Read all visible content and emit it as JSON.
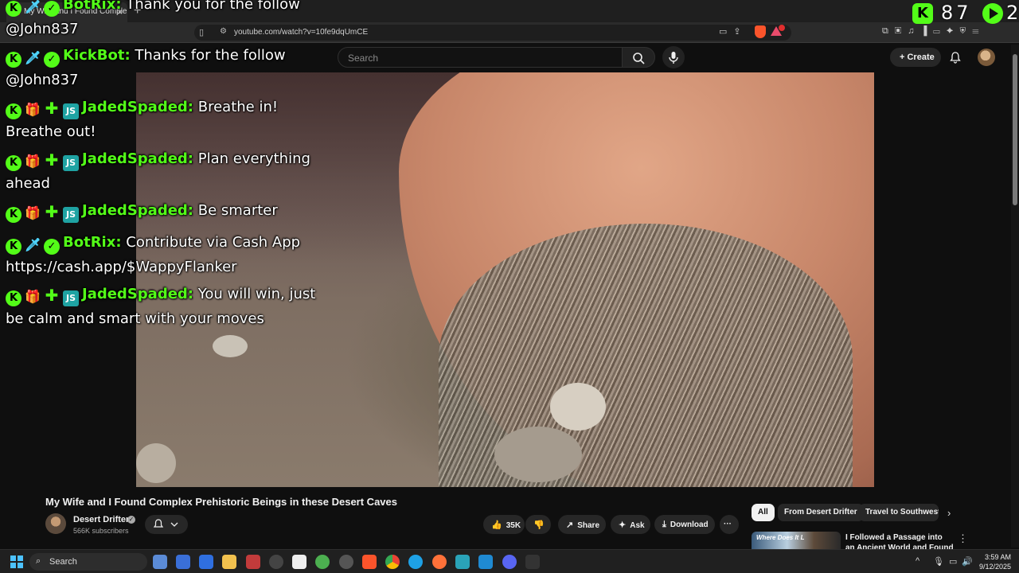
{
  "browser": {
    "tab_title": "My Wife and I Found Comple",
    "tab_close_glyph": "×",
    "new_tab_glyph": "+",
    "url": "youtube.com/watch?v=10fe9dqUmCE"
  },
  "youtube": {
    "search_placeholder": "Search",
    "create_label": "Create",
    "video": {
      "title": "My Wife and I Found Complex Prehistoric Beings in these Desert Caves",
      "channel_name": "Desert Drifter",
      "channel_subs": "566K subscribers",
      "likes": "35K",
      "share_label": "Share",
      "ask_label": "Ask",
      "download_label": "Download",
      "more_glyph": "···"
    },
    "chips": [
      {
        "label": "All",
        "active": true
      },
      {
        "label": "From Desert Drifter",
        "active": false
      },
      {
        "label": "Travel to Southweste",
        "active": false
      }
    ],
    "recommendation": {
      "thumb_text": "Where Does It L",
      "title": "I Followed a Passage into an Ancient World and Found This"
    }
  },
  "overlay": {
    "counter_left": "87",
    "counter_right": "2",
    "chat": [
      {
        "user": "BotRix:",
        "text": "Thank you for the follow @John837",
        "badges": "bot"
      },
      {
        "user": "KickBot:",
        "text": "Thanks for the follow @John837",
        "badges": "bot"
      },
      {
        "user": "JadedSpaded:",
        "text": "Breathe in! Breathe out!",
        "badges": "sub"
      },
      {
        "user": "JadedSpaded:",
        "text": "Plan everything ahead",
        "badges": "sub"
      },
      {
        "user": "JadedSpaded:",
        "text": "Be smarter",
        "badges": "sub"
      },
      {
        "user": "BotRix:",
        "text": "Contribute via Cash App https://cash.app/$WappyFlanker",
        "badges": "bot"
      },
      {
        "user": "JadedSpaded:",
        "text": "You will win, just be calm and smart with your moves",
        "badges": "sub"
      }
    ]
  },
  "taskbar": {
    "search_label": "Search",
    "time": "3:59 AM",
    "date": "9/12/2025"
  },
  "colors": {
    "kick_green": "#53fc18",
    "youtube_bg": "#0f0f0f",
    "accent_blue": "#4cc2ff"
  },
  "icons": [
    "kick-icon",
    "search-icon",
    "mic-icon",
    "bell-icon",
    "like-icon",
    "dislike-icon",
    "share-icon",
    "ask-icon",
    "download-icon",
    "windows-icon"
  ]
}
